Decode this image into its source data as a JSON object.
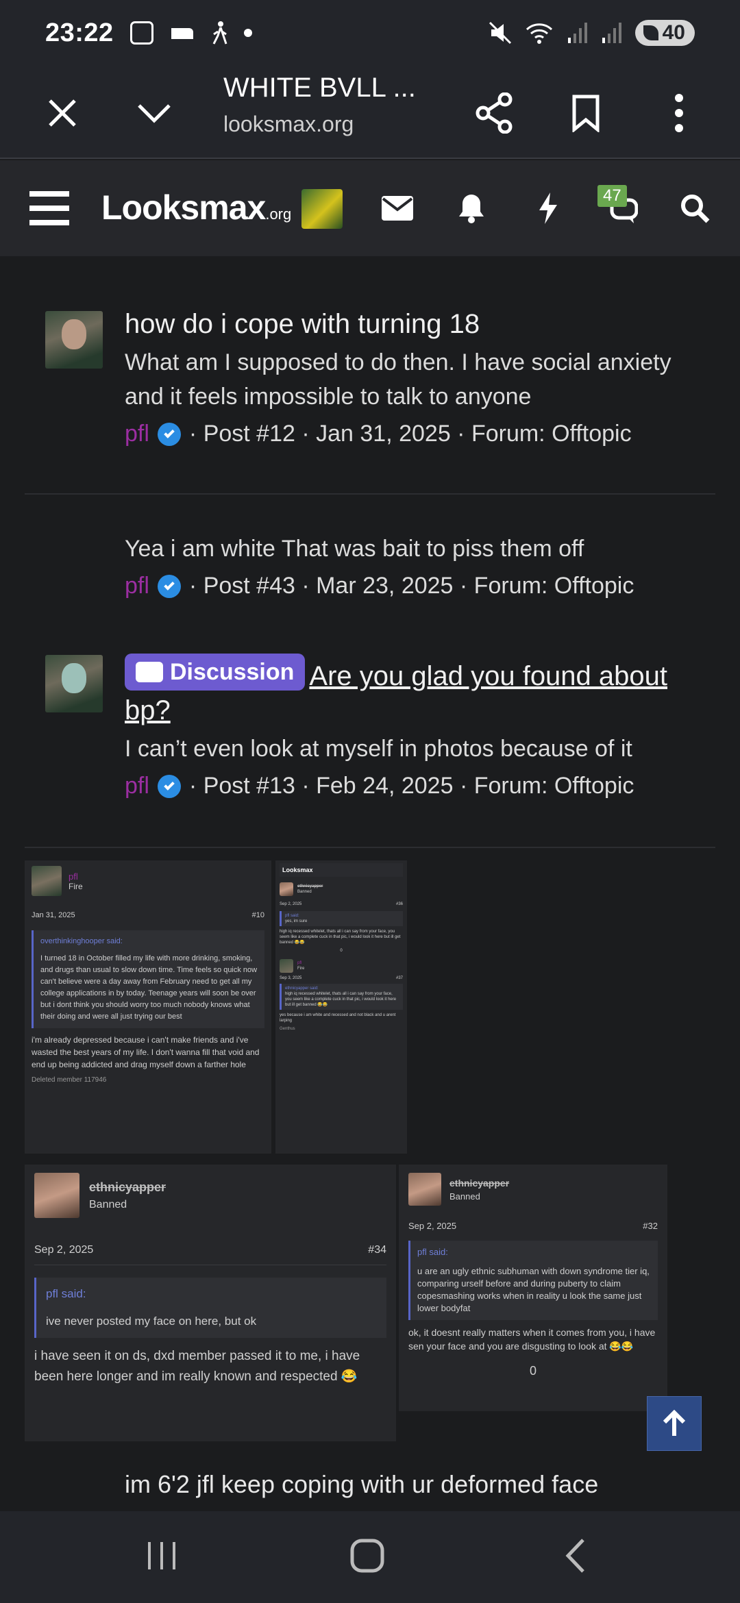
{
  "status": {
    "time": "23:22",
    "battery": "40"
  },
  "browser": {
    "title": "WHITE BVLL ...",
    "url": "looksmax.org"
  },
  "site": {
    "logo_main": "Looksmax",
    "logo_suffix": ".org",
    "alerts_badge": "47"
  },
  "results": [
    {
      "title": "how do i cope with turning 18",
      "snippet": "What am I supposed to do then. I have social anxiety and it feels impossible to talk to anyone",
      "user": "pfl",
      "meta": "· Post #12 · Jan 31, 2025 · Forum: Offtopic"
    },
    {
      "snippet": "Yea i am white That was bait to piss them off",
      "user": "pfl",
      "meta": "· Post #43 · Mar 23, 2025 · Forum: Offtopic"
    },
    {
      "tag": "Discussion",
      "title": "Are you glad you found about bp?",
      "snippet": "I can’t even look at myself in photos because of it",
      "user": "pfl",
      "meta": "· Post #13 · Feb 24, 2025 · Forum: Offtopic"
    }
  ],
  "collage": {
    "shot1": {
      "user": "pfl",
      "role": "Fire",
      "date": "Jan 31, 2025",
      "post": "#10",
      "quote_by": "overthinkinghooper said:",
      "quote": "I turned 18 in October filled my life with more drinking, smoking, and drugs than usual to slow down time. Time feels so quick now can't believe were a day away from February need to get all my college applications in by today. Teenage years will soon be over but i dont think you should worry too much nobody knows what their doing and were all just trying our best",
      "reply": "i'm already depressed because i can't make friends and i've wasted the best years of my life. I don't wanna fill that void and end up being addicted and drag myself down a farther hole",
      "reaction": "Deleted member 117946"
    },
    "shot2": {
      "user": "ethnicyapper",
      "role": "Banned",
      "date": "Sep 2, 2025",
      "post": "#34",
      "quote_by": "pfl said:",
      "quote": "ive never posted my face on here, but ok",
      "reply": "i have seen it on ds, dxd member passed it to me, i have been here longer and im really known and respected 😂"
    },
    "shot3": {
      "user": "ethnicyapper",
      "role": "Banned",
      "date": "Sep 2, 2025",
      "post": "#32",
      "quote_by": "pfl said:",
      "quote": "u are an ugly ethnic subhuman with down syndrome tier iq, comparing urself before and during puberty to claim copesmashing works when in reality u look the same just lower bodyfat",
      "reply": "ok, it doesnt really matters when it comes from you, i have sen your face and you are disgusting to look at 😂😂",
      "votes": "0"
    },
    "shot4": {
      "logo": "Looksmax",
      "user1": "ethnicyapper",
      "role1": "Banned",
      "date1": "Sep 2, 2025",
      "post1": "#36",
      "quote1_by": "pfl said:",
      "quote1": "yes, im sure",
      "text1": "high iq recessed whitelet, thats all i can say from your face, you seem like a complete cuck in that pic, i would look it here but ill get banned 😂😂",
      "votes": "0",
      "user2": "pfl",
      "role2": "Fire",
      "date2": "Sep 3, 2025",
      "post2": "#37",
      "quote2_by": "ethnicyapper said:",
      "quote2": "high iq recessed whitelet, thats all i can say from your face, you seem like a complete cuck in that pic, i would look it here but ill get banned 😂😂",
      "text2": "yes because i am white and recessed and not black and u arent larping",
      "reaction": "Genthus"
    }
  },
  "bottom_text": "im 6'2 jfl keep coping with ur deformed face"
}
